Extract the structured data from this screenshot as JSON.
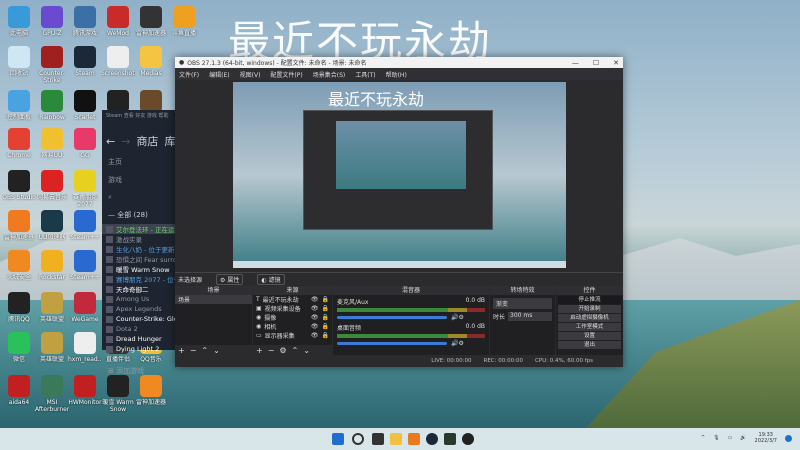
{
  "watermark": "最近不玩永劫",
  "desktop_icons": [
    {
      "label": "此电脑",
      "color": "#3a9ad9"
    },
    {
      "label": "GPU-Z",
      "color": "#6a4ad0"
    },
    {
      "label": "腾讯游戏",
      "color": "#3b6fa8"
    },
    {
      "label": "WeMod",
      "color": "#c92a2a"
    },
    {
      "label": "雷神加速器",
      "color": "#333"
    },
    {
      "label": "斗鱼直播",
      "color": "#f0a020"
    },
    {
      "label": "回收站",
      "color": "#cfe6f5"
    },
    {
      "label": "Counter-Strike",
      "color": "#a02020"
    },
    {
      "label": "Steam",
      "color": "#1b2838"
    },
    {
      "label": "Screenshots",
      "color": "#eee"
    },
    {
      "label": "Medias",
      "color": "#f5c542"
    },
    {
      "label": "控制面板",
      "color": "#49a3e0"
    },
    {
      "label": "Rainbow",
      "color": "#2a8a3a"
    },
    {
      "label": "Scarlet",
      "color": "#111"
    },
    {
      "label": "G HUB",
      "color": "#222"
    },
    {
      "label": "Warm Snow",
      "color": "#6a4a2a"
    },
    {
      "label": "Chrome",
      "color": "#e34133"
    },
    {
      "label": "网易UU",
      "color": "#f0c030"
    },
    {
      "label": "GG",
      "color": "#e83a6a"
    },
    {
      "label": "OBS Studio",
      "color": "#222"
    },
    {
      "label": "网易云音乐",
      "color": "#d22"
    },
    {
      "label": "赛博朋克 2077",
      "color": "#e8d020"
    },
    {
      "label": "雷神加速器",
      "color": "#f07a20"
    },
    {
      "label": "UU加速器",
      "color": "#1a3a4a"
    },
    {
      "label": "Steam++",
      "color": "#2a6ad0"
    },
    {
      "label": "火绒安全",
      "color": "#f08a20"
    },
    {
      "label": "Rockstar",
      "color": "#f0b020"
    },
    {
      "label": "Steam++",
      "color": "#2a6ad0"
    },
    {
      "label": "腾讯QQ",
      "color": "#222"
    },
    {
      "label": "英雄联盟",
      "color": "#c0a040"
    },
    {
      "label": "WeGame",
      "color": "#c02a3a"
    },
    {
      "label": "微信",
      "color": "#2ac05a"
    },
    {
      "label": "英雄联盟",
      "color": "#c0a040"
    },
    {
      "label": "hxm_read...",
      "color": "#eee"
    },
    {
      "label": "直播伴侣",
      "color": "#333"
    },
    {
      "label": "QQ音乐",
      "color": "#f0c030"
    },
    {
      "label": "aida64",
      "color": "#c02020"
    },
    {
      "label": "MSI Afterburner",
      "color": "#3a7a5a"
    },
    {
      "label": "HWMonitor",
      "color": "#c02020"
    },
    {
      "label": "暖雪 Warm Snow",
      "color": "#222"
    },
    {
      "label": "雷神加速器",
      "color": "#f08a20"
    }
  ],
  "steam": {
    "tabs": "Steam 查看 好友 游戏 帮助",
    "nav_store": "商店",
    "nav_lib": "库",
    "home": "主页",
    "games": "游戏",
    "section": "— 全部",
    "count": "(28)",
    "games_list": [
      {
        "name": "艾尔登法环 - 正在运行",
        "color": "#6ad36a"
      },
      {
        "name": "激战实录",
        "color": "#8f98a0"
      },
      {
        "name": "生化八奶 - 位于更新队列",
        "color": "#57a0e0"
      },
      {
        "name": "恐惧之间 Fear surrounds",
        "color": "#8f98a0"
      },
      {
        "name": "暖雪 Warm Snow",
        "color": "#fff"
      },
      {
        "name": "赛博朋克 2077 - 位于更新队列",
        "color": "#57a0e0"
      },
      {
        "name": "天命奇御二",
        "color": "#fff"
      },
      {
        "name": "Among Us",
        "color": "#8f98a0"
      },
      {
        "name": "Apex Legends",
        "color": "#8f98a0"
      },
      {
        "name": "Counter-Strike: Global Offensive",
        "color": "#fff"
      },
      {
        "name": "Dota 2",
        "color": "#8f98a0"
      },
      {
        "name": "Dread Hunger",
        "color": "#fff"
      },
      {
        "name": "Dying Light 2",
        "color": "#fff"
      }
    ],
    "add_game": "添加游戏"
  },
  "obs": {
    "title": "OBS 27.1.3 (64-bit, windows) - 配置文件: 未命名 - 场景: 未命名",
    "menu": [
      "文件(F)",
      "编辑(E)",
      "视图(V)",
      "配置文件(P)",
      "场景集合(S)",
      "工具(T)",
      "帮助(H)"
    ],
    "preview_text": "最近不玩永劫",
    "no_source": "未选择源",
    "props": "属性",
    "filters": "滤镜",
    "docks": {
      "scenes": "场景",
      "sources": "来源",
      "mixer": "混音器",
      "transitions": "转场特效",
      "controls": "控件"
    },
    "scene_items": [
      "场景"
    ],
    "source_items": [
      {
        "icon": "T",
        "name": "最近不玩永劫"
      },
      {
        "icon": "▣",
        "name": "视频采集设备"
      },
      {
        "icon": "◉",
        "name": "摄像"
      },
      {
        "icon": "◉",
        "name": "相机"
      },
      {
        "icon": "▭",
        "name": "显示器采集"
      }
    ],
    "mixer": [
      {
        "name": "麦克风/Aux",
        "db": "0.0 dB"
      },
      {
        "name": "桌面音频",
        "db": "0.0 dB"
      }
    ],
    "transition": {
      "type": "渐变",
      "duration_label": "时长",
      "duration": "300 ms"
    },
    "controls": [
      "停止推流",
      "开始录制",
      "启动虚拟摄像机",
      "工作室模式",
      "设置",
      "退出"
    ],
    "status": {
      "live": "LIVE: 00:00:00",
      "rec": "REC: 00:00:00",
      "cpu": "CPU: 0.4%, 60.00 fps"
    }
  },
  "taskbar": {
    "time": "19:33",
    "date": "2022/3/7"
  }
}
